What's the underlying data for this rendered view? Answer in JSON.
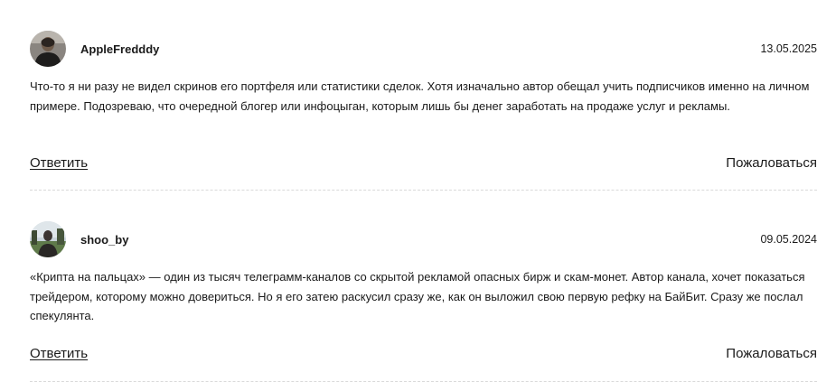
{
  "comments": [
    {
      "username": "AppleFredddy",
      "date": "13.05.2025",
      "text": "Что-то я ни разу не видел скринов его портфеля или статистики сделок. Хотя изначально автор обещал учить подписчиков именно на личном примере. Подозреваю, что очередной блогер или инфоцыган, которым лишь бы денег заработать на продаже услуг и рекламы.",
      "reply_label": "Ответить",
      "report_label": "Пожаловаться",
      "avatar_icon": "user-photo-avatar"
    },
    {
      "username": "shoo_by",
      "date": "09.05.2024",
      "text": "«Крипта на пальцах» — один из тысяч телеграмм-каналов со скрытой рекламой опасных бирж и скам-монет. Автор канала, хочет показаться трейдером, которому можно довериться. Но я его затею раскусил сразу же, как он выложил свою первую рефку на БайБит. Сразу же послал спекулянта.",
      "reply_label": "Ответить",
      "report_label": "Пожаловаться",
      "avatar_icon": "user-photo-avatar"
    }
  ]
}
